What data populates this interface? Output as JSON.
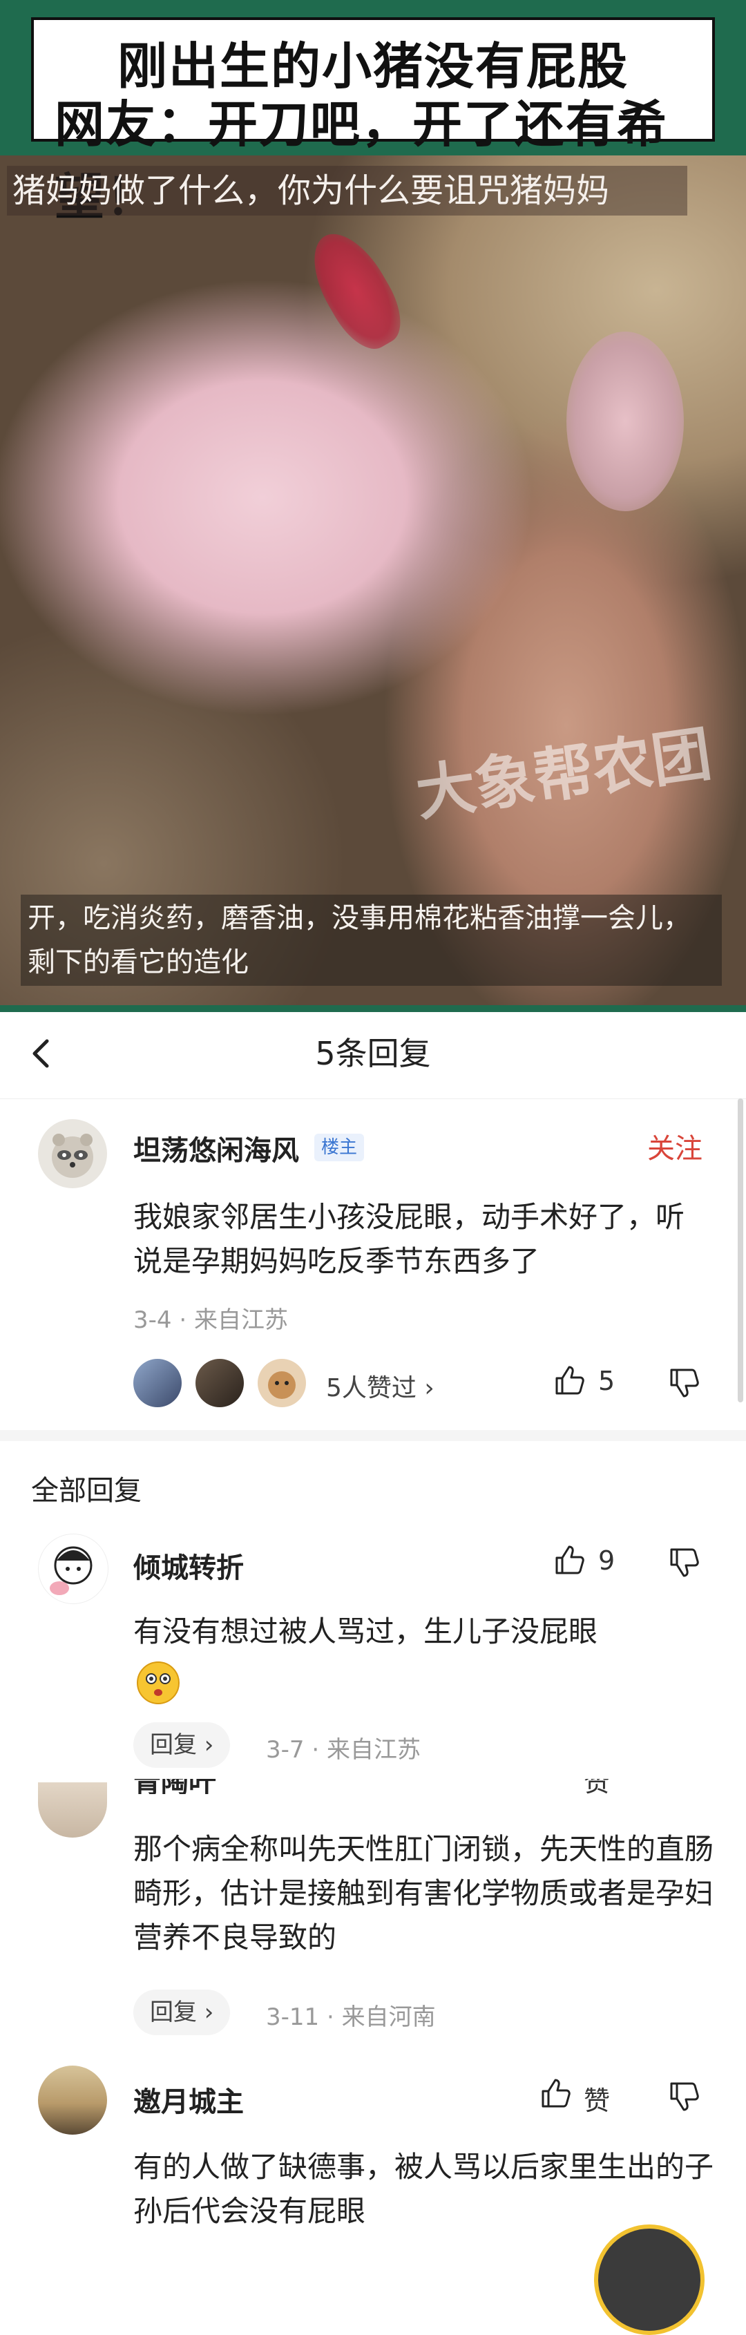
{
  "video": {
    "title_line1": "刚出生的小猪没有屁股",
    "title_line2": "网友：开刀吧，开了还有希望！",
    "subtitle": "猪妈妈做了什么，你为什么要诅咒猪妈妈",
    "watermark": "大象帮农团",
    "caption": "开，吃消炎药，磨香油，没事用棉花粘香油撑一会儿，剩下的看它的造化"
  },
  "header": {
    "title": "5条回复",
    "back_icon": "chevron-left-icon"
  },
  "main_comment": {
    "author": "坦荡悠闲海风",
    "badge": "楼主",
    "follow_label": "关注",
    "text": "我娘家邻居生小孩没屁眼，动手术好了，听说是孕期妈妈吃反季节东西多了",
    "meta": "3-4 · 来自江苏",
    "likers_text": "5人赞过 ›",
    "like_count": "5"
  },
  "replies_section": {
    "title": "全部回复",
    "reply_label": "回复 ›",
    "replies": [
      {
        "author": "倾城转折",
        "like_count": "9",
        "text": "有没有想过被人骂过，生儿子没屁眼",
        "meta": "3-7 · 来自江苏"
      },
      {
        "author": "青陶叶",
        "like_count": "赞",
        "text": "那个病全称叫先天性肛门闭锁，先天性的直肠畸形，估计是接触到有害化学物质或者是孕妇营养不良导致的",
        "meta": "3-11 · 来自河南"
      },
      {
        "author": "邀月城主",
        "like_count": "赞",
        "text": "有的人做了缺德事，被人骂以后家里生出的子孙后代会没有屁眼",
        "meta": ""
      }
    ]
  },
  "colors": {
    "accent_red": "#d9453a",
    "badge_blue": "#3b76d1",
    "video_green": "#1f6b4e"
  }
}
